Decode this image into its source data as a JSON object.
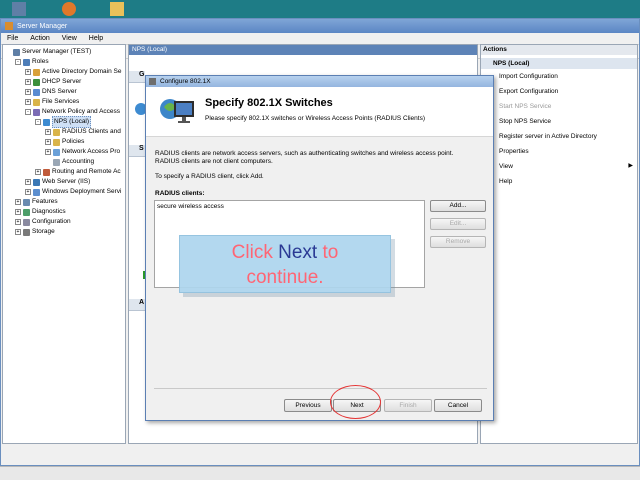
{
  "window": {
    "title": "Server Manager"
  },
  "menu": [
    "File",
    "Action",
    "View",
    "Help"
  ],
  "tree": {
    "items": [
      {
        "label": "Server Manager (TEST)",
        "indent": 0,
        "expander": ""
      },
      {
        "label": "Roles",
        "indent": 1,
        "expander": "-"
      },
      {
        "label": "Active Directory Domain Se",
        "indent": 2,
        "expander": "+"
      },
      {
        "label": "DHCP Server",
        "indent": 2,
        "expander": "+"
      },
      {
        "label": "DNS Server",
        "indent": 2,
        "expander": "+"
      },
      {
        "label": "File Services",
        "indent": 2,
        "expander": "+"
      },
      {
        "label": "Network Policy and Access",
        "indent": 2,
        "expander": "-"
      },
      {
        "label": "NPS (Local)",
        "indent": 3,
        "expander": "-"
      },
      {
        "label": "RADIUS Clients and",
        "indent": 4,
        "expander": "+"
      },
      {
        "label": "Policies",
        "indent": 4,
        "expander": "+"
      },
      {
        "label": "Network Access Pro",
        "indent": 4,
        "expander": "+"
      },
      {
        "label": "Accounting",
        "indent": 4,
        "expander": ""
      },
      {
        "label": "Routing and Remote Ac",
        "indent": 3,
        "expander": "+"
      },
      {
        "label": "Web Server (IIS)",
        "indent": 2,
        "expander": "+"
      },
      {
        "label": "Windows Deployment Servi",
        "indent": 2,
        "expander": "+"
      },
      {
        "label": "Features",
        "indent": 1,
        "expander": "+"
      },
      {
        "label": "Diagnostics",
        "indent": 1,
        "expander": "+"
      },
      {
        "label": "Configuration",
        "indent": 1,
        "expander": "+"
      },
      {
        "label": "Storage",
        "indent": 1,
        "expander": "+"
      }
    ]
  },
  "center": {
    "header": "NPS (Local)"
  },
  "actions": {
    "header": "Actions",
    "group": "NPS (Local)",
    "items": [
      {
        "label": "Import Configuration",
        "disabled": false,
        "submenu": false
      },
      {
        "label": "Export Configuration",
        "disabled": false,
        "submenu": false
      },
      {
        "label": "Start NPS Service",
        "disabled": true,
        "submenu": false
      },
      {
        "label": "Stop NPS Service",
        "disabled": false,
        "submenu": false
      },
      {
        "label": "Register server in Active Directory",
        "disabled": false,
        "submenu": false
      },
      {
        "label": "Properties",
        "disabled": false,
        "submenu": false
      },
      {
        "label": "View",
        "disabled": false,
        "submenu": true
      },
      {
        "label": "Help",
        "disabled": false,
        "submenu": false
      }
    ]
  },
  "dialog": {
    "title": "Configure 802.1X",
    "heading": "Specify 802.1X Switches",
    "description": "Please specify 802.1X switches or Wireless Access Points (RADIUS Clients)",
    "para1a": "RADIUS clients are network access servers, such as authenticating switches and wireless access point.",
    "para1b": "RADIUS clients are not client computers.",
    "para2": "To specify a RADIUS client, click Add.",
    "list_label": "RADIUS clients:",
    "list_items": [
      "secure wireless access"
    ],
    "buttons": {
      "add": "Add...",
      "edit": "Edit...",
      "remove": "Remove"
    },
    "nav": {
      "previous": "Previous",
      "next": "Next",
      "finish": "Finish",
      "cancel": "Cancel"
    }
  },
  "callout": {
    "prefix": "Click ",
    "emph": "Next",
    "suffix": " to",
    "line2": "continue."
  },
  "colors": {
    "callout_text": "#ff5a6a",
    "callout_emph": "#1a2b8c",
    "highlight": "#e53535"
  }
}
